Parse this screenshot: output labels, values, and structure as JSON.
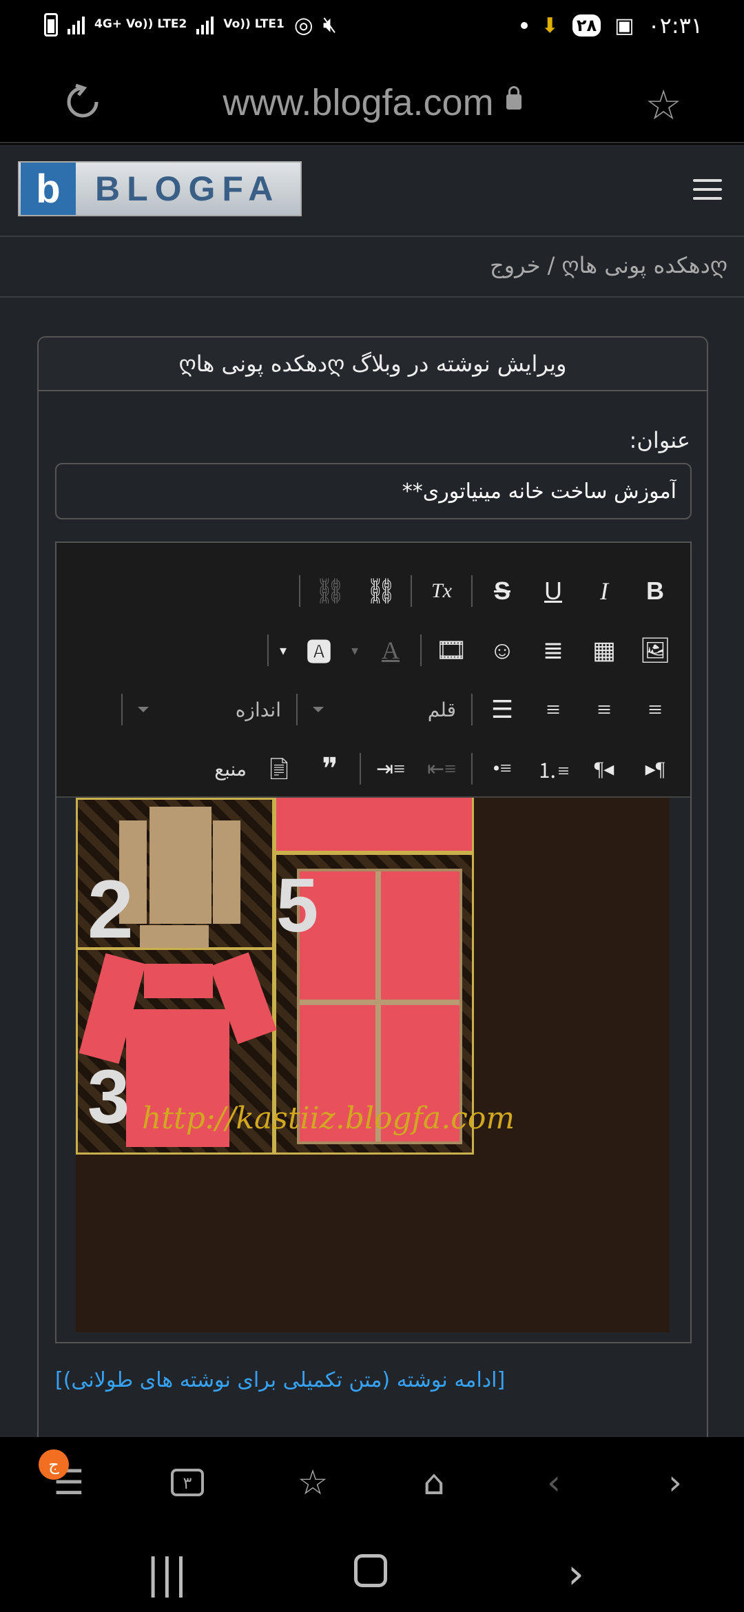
{
  "status_bar": {
    "net1": "4G+ Vo)) LTE2",
    "net2": "Vo)) LTE1",
    "badge": "۲۸",
    "time": "۰۲:۳۱"
  },
  "browser": {
    "url": "www.blogfa.com"
  },
  "site": {
    "logo_text": "BLOGFA",
    "logo_mark": "b",
    "breadcrumb_blog": "ღدهکده پونی هاღ",
    "breadcrumb_sep": "/",
    "breadcrumb_logout": "خروج"
  },
  "card": {
    "header": "ویرایش نوشته در وبلاگ ღدهکده پونی هاღ",
    "title_label": "عنوان:",
    "title_value": "آموزش ساخت خانه مینیاتوری**"
  },
  "toolbar": {
    "font_label": "قلم",
    "size_label": "اندازه",
    "source_label": "منبع",
    "bold": "B",
    "italic": "I",
    "underline": "U",
    "strike": "S",
    "clear_format": "Tx",
    "quote": "❞"
  },
  "content": {
    "watermark": "http://kastiiz.blogfa.com",
    "num2": "2",
    "num3": "3",
    "num5": "5",
    "more_link": "[ادامه نوشته (متن تکمیلی برای نوشته های طولانی)]"
  },
  "bottom_bar": {
    "badge": "ج",
    "tabs": "۳"
  }
}
